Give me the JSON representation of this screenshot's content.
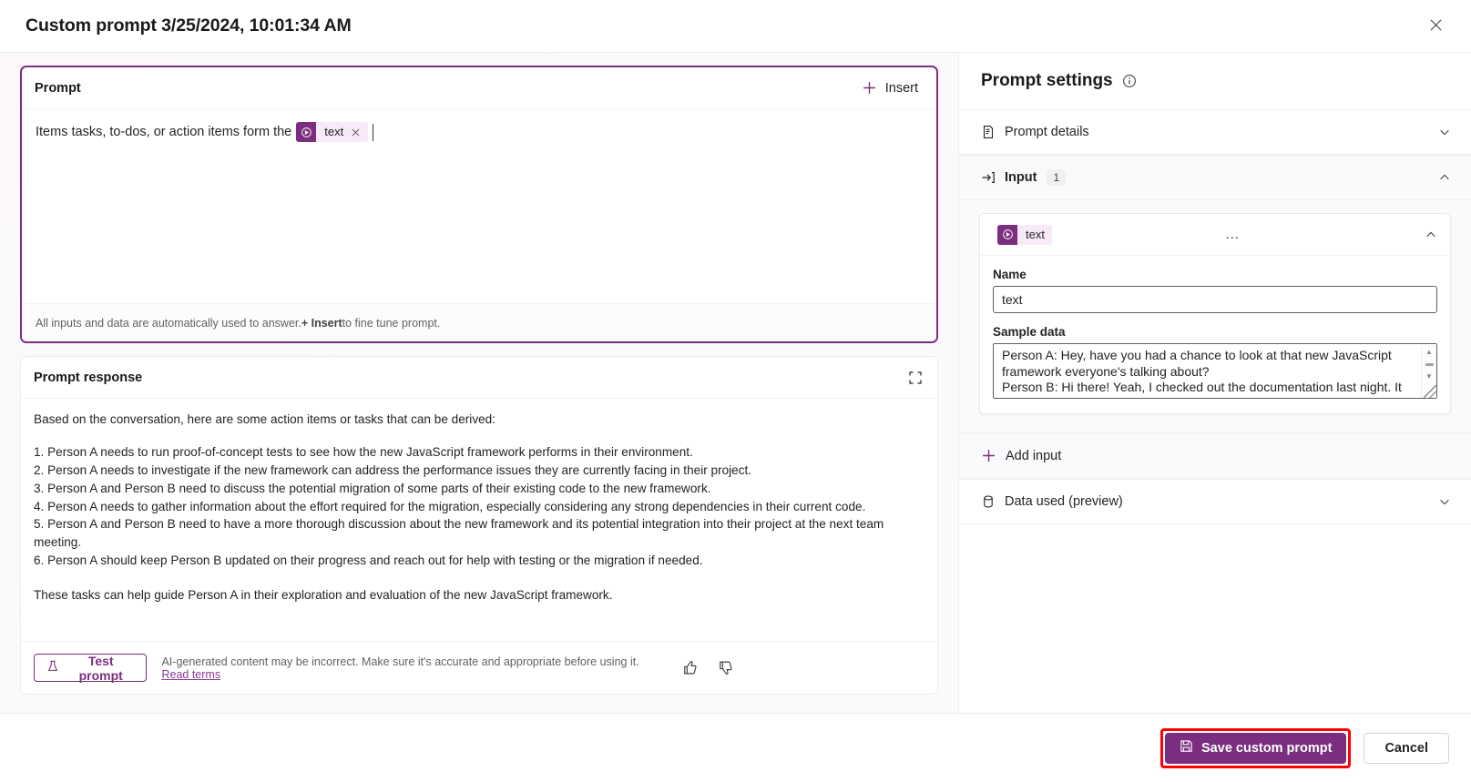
{
  "window": {
    "title": "Custom prompt 3/25/2024, 10:01:34 AM",
    "close_label": "✕"
  },
  "prompt_card": {
    "title": "Prompt",
    "insert_label": "Insert",
    "text_before_chip": "Items tasks, to-dos, or action items form the",
    "chip": {
      "label": "text",
      "icon": "copilot-icon",
      "close": "✕"
    },
    "footer_prefix": "All inputs and data are automatically used to answer. ",
    "footer_bold": "+ Insert",
    "footer_suffix": " to fine tune prompt."
  },
  "response_card": {
    "title": "Prompt response",
    "intro": "Based on the conversation, here are some action items or tasks that can be derived:",
    "items": [
      "1. Person A needs to run proof-of-concept tests to see how the new JavaScript framework performs in their environment.",
      "2. Person A needs to investigate if the new framework can address the performance issues they are currently facing in their project.",
      "3. Person A and Person B need to discuss the potential migration of some parts of their existing code to the new framework.",
      "4. Person A needs to gather information about the effort required for the migration, especially considering any strong dependencies in their current code.",
      "5. Person A and Person B need to have a more thorough discussion about the new framework and its potential integration into their project at the next team meeting.",
      "6. Person A should keep Person B updated on their progress and reach out for help with testing or the migration if needed."
    ],
    "outro": "These tasks can help guide Person A in their exploration and evaluation of the new JavaScript framework.",
    "test_button": "Test prompt",
    "disclaimer": "AI-generated content may be incorrect. Make sure it's accurate and appropriate before using it.",
    "read_terms": "Read terms"
  },
  "settings": {
    "title": "Prompt settings",
    "sections": [
      {
        "label": "Prompt details",
        "icon": "document-icon",
        "expanded": false,
        "chevron": "⌄"
      },
      {
        "label": "Input",
        "icon": "input-arrow-icon",
        "count": "1",
        "expanded": true,
        "chevron": "⌃"
      },
      {
        "label": "Data used (preview)",
        "icon": "database-icon",
        "expanded": false,
        "chevron": "⌄"
      }
    ],
    "input_card": {
      "chip_label": "text",
      "menu": "…",
      "collapse": "⌃",
      "name_label": "Name",
      "name_value": "text",
      "sample_label": "Sample data",
      "sample_value": "Person A: Hey, have you had a chance to look at that new JavaScript framework everyone's talking about?\nPerson B: Hi there! Yeah, I checked out the documentation last night. It looks promising. Performance-wise, it looks better than what"
    },
    "add_input_label": "Add input"
  },
  "footer": {
    "save_label": "Save custom prompt",
    "cancel_label": "Cancel"
  },
  "colors": {
    "accent": "#7b2e7f",
    "chip_bg": "#f7e9f7",
    "highlight": "#ff0000",
    "panel_bg": "#faf9fb"
  }
}
